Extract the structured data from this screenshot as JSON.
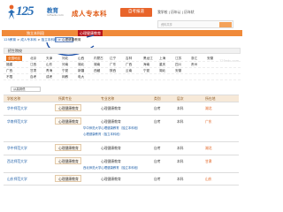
{
  "header": {
    "logo_number": "125",
    "logo_text": "教育",
    "logo_url": "125edu.com",
    "site_title": "成人专本科",
    "button_label": "自考报道",
    "top_links": "我学校 | 历年认 | 历年状",
    "login_tip": "资料共享"
  },
  "nav": {
    "item_1": "独立本科段",
    "item_2": "心理健康教育"
  },
  "breadcrumb": {
    "home": "125教育",
    "sep1": " > ",
    "level1": "成人专本科",
    "sep2": " > ",
    "level2": "独立本科段",
    "sep3": " > ",
    "current": "心理健康教育"
  },
  "filter": {
    "title": "招生院校",
    "watermark": "125edu.com",
    "rows": [
      [
        {
          "text": "全国地区",
          "selected": true
        },
        {
          "text": "北京"
        },
        {
          "text": "天津"
        },
        {
          "text": "河北"
        },
        {
          "text": "山西"
        },
        {
          "text": "内蒙古"
        },
        {
          "text": "辽宁"
        },
        {
          "text": "吉林"
        },
        {
          "text": "黑龙江"
        },
        {
          "text": "上海"
        },
        {
          "text": "江苏"
        },
        {
          "text": "浙江"
        },
        {
          "text": "安徽"
        }
      ],
      [
        {
          "text": "福建"
        },
        {
          "text": "江西"
        },
        {
          "text": "山东"
        },
        {
          "text": "河南"
        },
        {
          "text": "湖北"
        },
        {
          "text": "湖南"
        },
        {
          "text": "广东"
        },
        {
          "text": "广西"
        },
        {
          "text": "海南"
        },
        {
          "text": "重庆"
        },
        {
          "text": "四川"
        },
        {
          "text": "贵州"
        }
      ],
      [
        {
          "text": "广西"
        },
        {
          "text": "甘肃"
        },
        {
          "text": "青海"
        },
        {
          "text": "宁夏"
        },
        {
          "text": "新疆"
        },
        {
          "text": "西藏"
        },
        {
          "text": "陕西"
        },
        {
          "text": "云南"
        },
        {
          "text": "宁夏"
        },
        {
          "text": "湖北"
        },
        {
          "text": "安徽"
        }
      ],
      [
        {
          "text": "不限"
        },
        {
          "text": "自考"
        },
        {
          "text": "成考"
        },
        {
          "text": "网教"
        },
        {
          "text": "电大"
        }
      ]
    ]
  },
  "sort": {
    "label": "排序：",
    "value": "从高到低"
  },
  "table": {
    "headers": [
      "学校名称",
      "所属专业",
      "专业名称",
      "类别",
      "层次",
      "所在地"
    ],
    "rows": [
      {
        "school": "华中师范大学",
        "major": "心理健康教育",
        "name": "心理健康教育",
        "type": "自考",
        "level": "本科",
        "loc": "湖北"
      },
      {
        "school": "华南师范大学",
        "major": "心理健康教育",
        "name": "心理健康教育",
        "type": "自考",
        "level": "本科",
        "loc": "广东",
        "sub": [
          "华中师范大学心理健康教育（独立本科段）",
          "心理健康教育（独立本科段）"
        ]
      },
      {
        "school": "华中师范大学",
        "major": "心理健康教育",
        "name": "心理健康教育",
        "type": "自考",
        "level": "本科",
        "loc": "湖北"
      },
      {
        "school": "西北师范大学",
        "major": "心理健康教育",
        "name": "心理健康教育",
        "type": "自考",
        "level": "本科",
        "loc": "甘肃",
        "sub": [
          "西北师范大学心理健康教育（独立本科段）"
        ]
      },
      {
        "school": "山东师范大学",
        "major": "心理健康教育",
        "name": "心理健康教育",
        "type": "自考",
        "level": "本科",
        "loc": "山东"
      }
    ]
  },
  "colors": {
    "nav": "#f08a3a",
    "nav_active": "#b8141b",
    "accent": "#e05a15",
    "link": "#1d5ea8"
  }
}
